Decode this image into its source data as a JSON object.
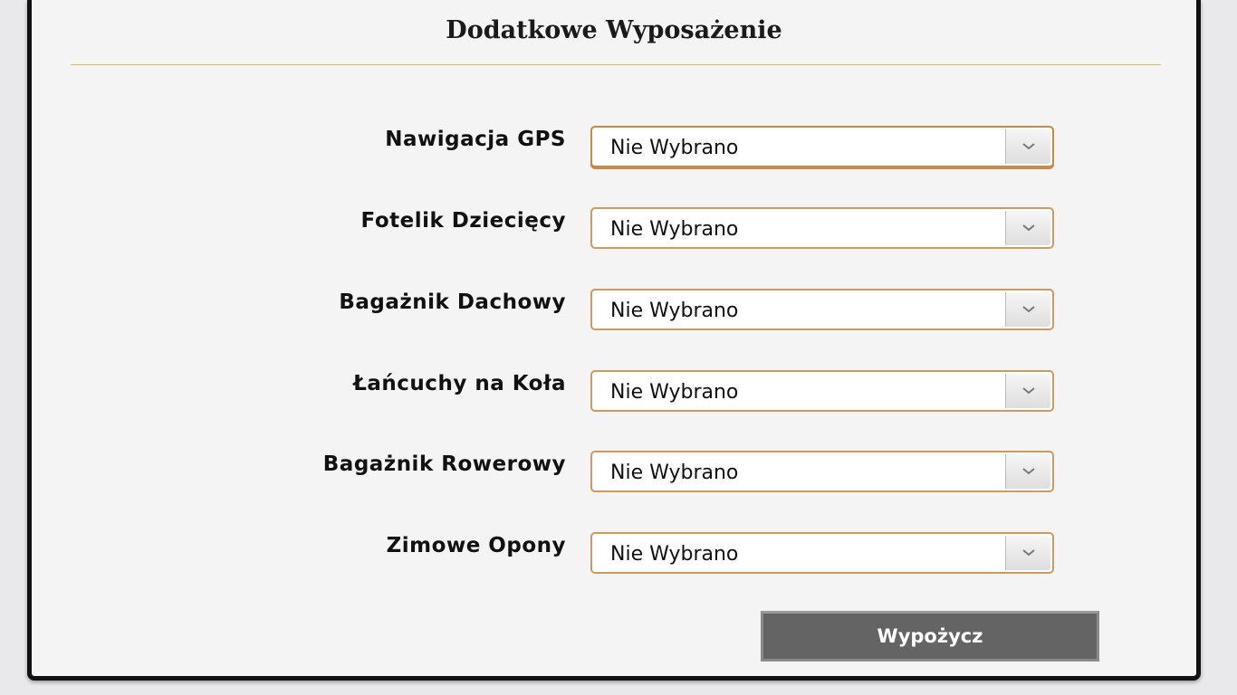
{
  "section": {
    "title": "Dodatkowe Wyposażenie"
  },
  "equipment": [
    {
      "label": "Nawigacja GPS",
      "value": "Nie Wybrano"
    },
    {
      "label": "Fotelik Dziecięcy",
      "value": "Nie Wybrano"
    },
    {
      "label": "Bagażnik Dachowy",
      "value": "Nie Wybrano"
    },
    {
      "label": "Łańcuchy na Koła",
      "value": "Nie Wybrano"
    },
    {
      "label": "Bagażnik Rowerowy",
      "value": "Nie Wybrano"
    },
    {
      "label": "Zimowe Opony",
      "value": "Nie Wybrano"
    }
  ],
  "actions": {
    "submit_label": "Wypożycz"
  },
  "icons": {
    "select_arrow": "chevron-down-icon"
  },
  "colors": {
    "accent_border": "#d19a5c",
    "divider": "#e0b866",
    "button_bg": "#646464"
  }
}
